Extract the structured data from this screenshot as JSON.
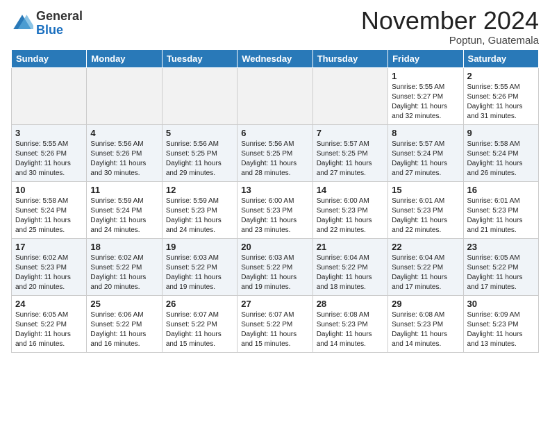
{
  "logo": {
    "general": "General",
    "blue": "Blue"
  },
  "title": "November 2024",
  "location": "Poptun, Guatemala",
  "weekdays": [
    "Sunday",
    "Monday",
    "Tuesday",
    "Wednesday",
    "Thursday",
    "Friday",
    "Saturday"
  ],
  "weeks": [
    [
      {
        "day": "",
        "info": ""
      },
      {
        "day": "",
        "info": ""
      },
      {
        "day": "",
        "info": ""
      },
      {
        "day": "",
        "info": ""
      },
      {
        "day": "",
        "info": ""
      },
      {
        "day": "1",
        "info": "Sunrise: 5:55 AM\nSunset: 5:27 PM\nDaylight: 11 hours\nand 32 minutes."
      },
      {
        "day": "2",
        "info": "Sunrise: 5:55 AM\nSunset: 5:26 PM\nDaylight: 11 hours\nand 31 minutes."
      }
    ],
    [
      {
        "day": "3",
        "info": "Sunrise: 5:55 AM\nSunset: 5:26 PM\nDaylight: 11 hours\nand 30 minutes."
      },
      {
        "day": "4",
        "info": "Sunrise: 5:56 AM\nSunset: 5:26 PM\nDaylight: 11 hours\nand 30 minutes."
      },
      {
        "day": "5",
        "info": "Sunrise: 5:56 AM\nSunset: 5:25 PM\nDaylight: 11 hours\nand 29 minutes."
      },
      {
        "day": "6",
        "info": "Sunrise: 5:56 AM\nSunset: 5:25 PM\nDaylight: 11 hours\nand 28 minutes."
      },
      {
        "day": "7",
        "info": "Sunrise: 5:57 AM\nSunset: 5:25 PM\nDaylight: 11 hours\nand 27 minutes."
      },
      {
        "day": "8",
        "info": "Sunrise: 5:57 AM\nSunset: 5:24 PM\nDaylight: 11 hours\nand 27 minutes."
      },
      {
        "day": "9",
        "info": "Sunrise: 5:58 AM\nSunset: 5:24 PM\nDaylight: 11 hours\nand 26 minutes."
      }
    ],
    [
      {
        "day": "10",
        "info": "Sunrise: 5:58 AM\nSunset: 5:24 PM\nDaylight: 11 hours\nand 25 minutes."
      },
      {
        "day": "11",
        "info": "Sunrise: 5:59 AM\nSunset: 5:24 PM\nDaylight: 11 hours\nand 24 minutes."
      },
      {
        "day": "12",
        "info": "Sunrise: 5:59 AM\nSunset: 5:23 PM\nDaylight: 11 hours\nand 24 minutes."
      },
      {
        "day": "13",
        "info": "Sunrise: 6:00 AM\nSunset: 5:23 PM\nDaylight: 11 hours\nand 23 minutes."
      },
      {
        "day": "14",
        "info": "Sunrise: 6:00 AM\nSunset: 5:23 PM\nDaylight: 11 hours\nand 22 minutes."
      },
      {
        "day": "15",
        "info": "Sunrise: 6:01 AM\nSunset: 5:23 PM\nDaylight: 11 hours\nand 22 minutes."
      },
      {
        "day": "16",
        "info": "Sunrise: 6:01 AM\nSunset: 5:23 PM\nDaylight: 11 hours\nand 21 minutes."
      }
    ],
    [
      {
        "day": "17",
        "info": "Sunrise: 6:02 AM\nSunset: 5:23 PM\nDaylight: 11 hours\nand 20 minutes."
      },
      {
        "day": "18",
        "info": "Sunrise: 6:02 AM\nSunset: 5:22 PM\nDaylight: 11 hours\nand 20 minutes."
      },
      {
        "day": "19",
        "info": "Sunrise: 6:03 AM\nSunset: 5:22 PM\nDaylight: 11 hours\nand 19 minutes."
      },
      {
        "day": "20",
        "info": "Sunrise: 6:03 AM\nSunset: 5:22 PM\nDaylight: 11 hours\nand 19 minutes."
      },
      {
        "day": "21",
        "info": "Sunrise: 6:04 AM\nSunset: 5:22 PM\nDaylight: 11 hours\nand 18 minutes."
      },
      {
        "day": "22",
        "info": "Sunrise: 6:04 AM\nSunset: 5:22 PM\nDaylight: 11 hours\nand 17 minutes."
      },
      {
        "day": "23",
        "info": "Sunrise: 6:05 AM\nSunset: 5:22 PM\nDaylight: 11 hours\nand 17 minutes."
      }
    ],
    [
      {
        "day": "24",
        "info": "Sunrise: 6:05 AM\nSunset: 5:22 PM\nDaylight: 11 hours\nand 16 minutes."
      },
      {
        "day": "25",
        "info": "Sunrise: 6:06 AM\nSunset: 5:22 PM\nDaylight: 11 hours\nand 16 minutes."
      },
      {
        "day": "26",
        "info": "Sunrise: 6:07 AM\nSunset: 5:22 PM\nDaylight: 11 hours\nand 15 minutes."
      },
      {
        "day": "27",
        "info": "Sunrise: 6:07 AM\nSunset: 5:22 PM\nDaylight: 11 hours\nand 15 minutes."
      },
      {
        "day": "28",
        "info": "Sunrise: 6:08 AM\nSunset: 5:23 PM\nDaylight: 11 hours\nand 14 minutes."
      },
      {
        "day": "29",
        "info": "Sunrise: 6:08 AM\nSunset: 5:23 PM\nDaylight: 11 hours\nand 14 minutes."
      },
      {
        "day": "30",
        "info": "Sunrise: 6:09 AM\nSunset: 5:23 PM\nDaylight: 11 hours\nand 13 minutes."
      }
    ]
  ]
}
